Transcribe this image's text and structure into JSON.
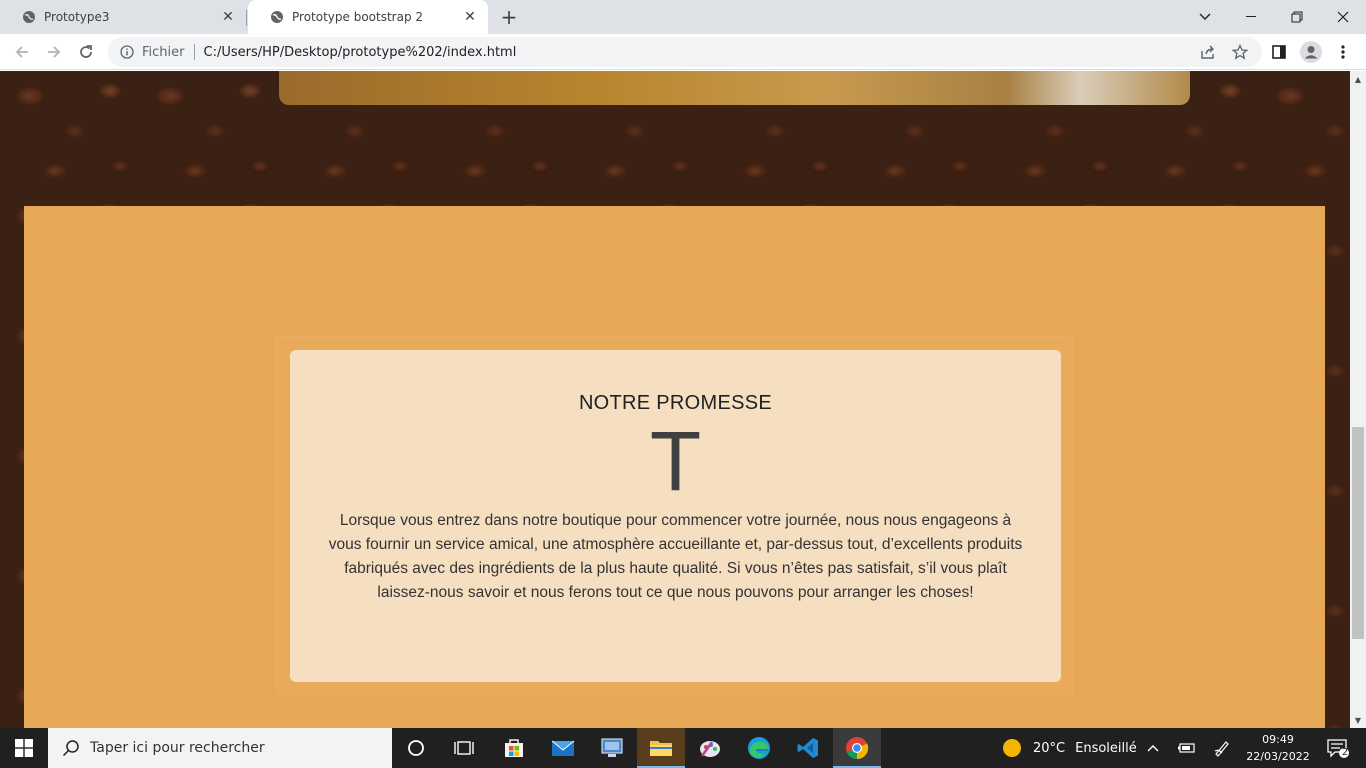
{
  "browser": {
    "tabs": [
      {
        "title": "Prototype3",
        "active": false
      },
      {
        "title": "Prototype bootstrap 2",
        "active": true
      }
    ],
    "address": {
      "scheme_label": "Fichier",
      "url": "C:/Users/HP/Desktop/prototype%202/index.html"
    }
  },
  "page": {
    "promise": {
      "title": "NOTRE PROMESSE",
      "letter": "T",
      "text": "Lorsque vous entrez dans notre boutique pour commencer votre journée, nous nous engageons à vous fournir un service amical, une atmosphère accueillante et, par-dessus tout, d’excellents produits fabriqués avec des ingrédients de la plus haute qualité. Si vous n’êtes pas satisfait, s’il vous plaît laissez-nous savoir et nous ferons tout ce que nous pouvons pour arranger les choses!"
    },
    "colors": {
      "section_bg": "#e6a756",
      "card_bg": "#f6dfc1",
      "background": "#3b2014"
    }
  },
  "taskbar": {
    "search_placeholder": "Taper ici pour rechercher",
    "weather": {
      "temp": "20°C",
      "condition": "Ensoleillé"
    },
    "clock": {
      "time": "09:49",
      "date": "22/03/2022"
    },
    "notifications": "2"
  }
}
